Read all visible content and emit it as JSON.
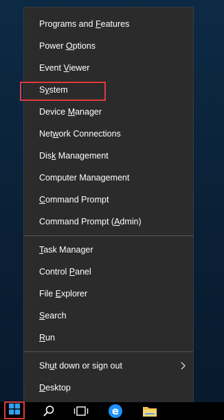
{
  "menu": {
    "items": [
      {
        "pre": "Programs and ",
        "u": "F",
        "post": "eatures"
      },
      {
        "pre": "Power ",
        "u": "O",
        "post": "ptions"
      },
      {
        "pre": "Event ",
        "u": "V",
        "post": "iewer"
      },
      {
        "pre": "S",
        "u": "y",
        "post": "stem"
      },
      {
        "pre": "Device ",
        "u": "M",
        "post": "anager"
      },
      {
        "pre": "Net",
        "u": "w",
        "post": "ork Connections"
      },
      {
        "pre": "Dis",
        "u": "k",
        "post": " Management"
      },
      {
        "pre": "Computer Mana",
        "u": "g",
        "post": "ement"
      },
      {
        "pre": "",
        "u": "C",
        "post": "ommand Prompt"
      },
      {
        "pre": "Command Prompt (",
        "u": "A",
        "post": "dmin)"
      },
      {
        "pre": "",
        "u": "T",
        "post": "ask Manager"
      },
      {
        "pre": "Control ",
        "u": "P",
        "post": "anel"
      },
      {
        "pre": "File ",
        "u": "E",
        "post": "xplorer"
      },
      {
        "pre": "",
        "u": "S",
        "post": "earch"
      },
      {
        "pre": "",
        "u": "R",
        "post": "un"
      },
      {
        "pre": "Sh",
        "u": "u",
        "post": "t down or sign out"
      },
      {
        "pre": "",
        "u": "D",
        "post": "esktop"
      }
    ],
    "submenu_icon": "chevron-right-icon"
  },
  "taskbar": {
    "icons": [
      "windows-start-icon",
      "search-icon",
      "task-view-icon",
      "edge-icon",
      "file-explorer-icon"
    ]
  },
  "colors": {
    "menu_bg": "#2b2b2b",
    "highlight": "#e03a3a",
    "taskbar": "#000000",
    "edge": "#1e90ff",
    "folder": "#f0c24a"
  }
}
